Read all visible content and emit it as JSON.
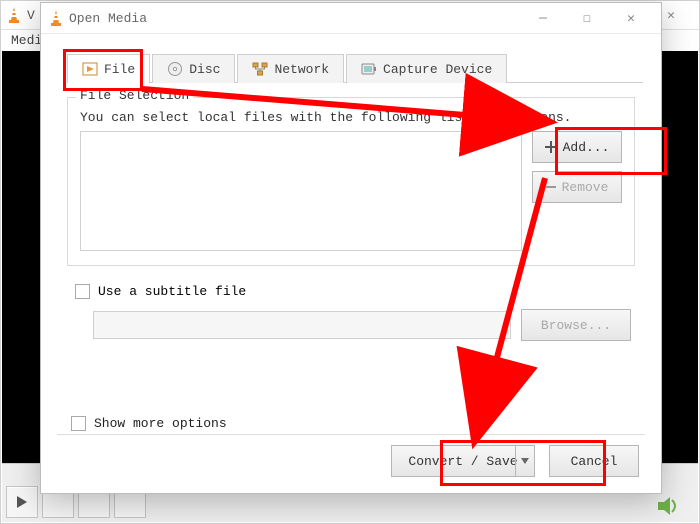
{
  "background": {
    "app_title_letter": "V",
    "menu_item": "Medi"
  },
  "dialog": {
    "title": "Open Media",
    "tabs": {
      "file": "File",
      "disc": "Disc",
      "network": "Network",
      "capture": "Capture Device"
    },
    "file_section": {
      "legend": "File Selection",
      "description": "You can select local files with the following list and buttons.",
      "add": "Add...",
      "remove": "Remove"
    },
    "subtitle": {
      "label": "Use a subtitle file",
      "browse": "Browse..."
    },
    "show_more": "Show more options",
    "convert": "Convert / Save",
    "cancel": "Cancel"
  }
}
